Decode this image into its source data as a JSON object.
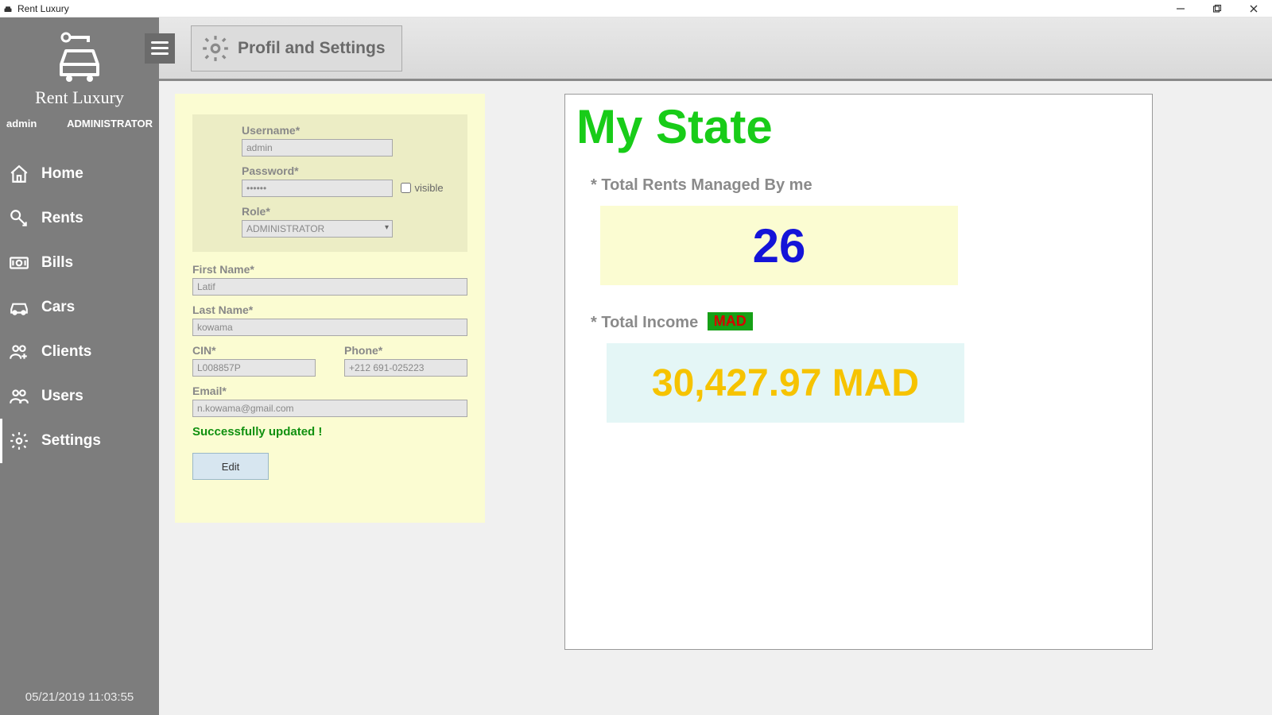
{
  "window": {
    "title": "Rent Luxury"
  },
  "sidebar": {
    "brand": "Rent Luxury",
    "username": "admin",
    "role": "ADMINISTRATOR",
    "items": [
      {
        "label": "Home",
        "icon": "home-icon"
      },
      {
        "label": "Rents",
        "icon": "rents-icon"
      },
      {
        "label": "Bills",
        "icon": "bills-icon"
      },
      {
        "label": "Cars",
        "icon": "cars-icon"
      },
      {
        "label": "Clients",
        "icon": "clients-icon"
      },
      {
        "label": "Users",
        "icon": "users-icon"
      },
      {
        "label": "Settings",
        "icon": "settings-icon"
      }
    ],
    "datetime": "05/21/2019 11:03:55"
  },
  "header": {
    "page_title": "Profil and Settings"
  },
  "profile_form": {
    "username_label": "Username*",
    "username_value": "admin",
    "password_label": "Password*",
    "password_value": "••••••",
    "visible_label": "visible",
    "role_label": "Role*",
    "role_value": "ADMINISTRATOR",
    "first_name_label": "First Name*",
    "first_name_value": "Latif",
    "last_name_label": "Last Name*",
    "last_name_value": "kowama",
    "cin_label": "CIN*",
    "cin_value": "L008857P",
    "phone_label": "Phone*",
    "phone_value": "+212 691-025223",
    "email_label": "Email*",
    "email_value": "n.kowama@gmail.com",
    "success_msg": "Successfully updated !",
    "edit_button": "Edit"
  },
  "stats": {
    "title": "My State",
    "rents_label": "* Total Rents Managed By me",
    "rents_value": "26",
    "income_label": "* Total Income",
    "currency_badge": "MAD",
    "income_value": "30,427.97 MAD"
  }
}
